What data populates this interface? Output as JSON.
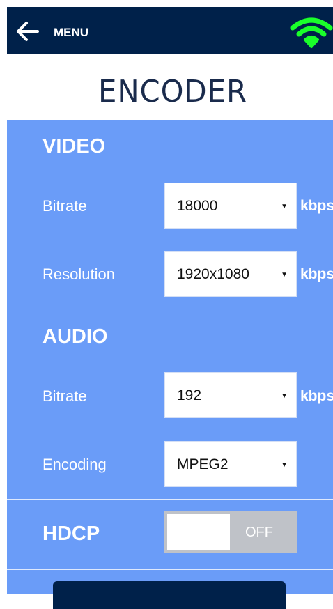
{
  "header": {
    "menu_label": "MENU",
    "back_icon": "arrow-left-icon",
    "status_icon": "wifi-icon",
    "wifi_color": "#1aff2a"
  },
  "page": {
    "title": "ENCODER"
  },
  "video": {
    "title": "VIDEO",
    "bitrate_label": "Bitrate",
    "bitrate_value": "18000",
    "bitrate_unit": "kbps",
    "resolution_label": "Resolution",
    "resolution_value": "1920x1080",
    "resolution_unit": "kbps"
  },
  "audio": {
    "title": "AUDIO",
    "bitrate_label": "Bitrate",
    "bitrate_value": "192",
    "bitrate_unit": "kbps",
    "encoding_label": "Encoding",
    "encoding_value": "MPEG2"
  },
  "hdcp": {
    "title": "HDCP",
    "state": "OFF"
  },
  "colors": {
    "header_bg": "#00214a",
    "panel_bg": "#6a9cf8",
    "toggle_bg": "#bfc2c8"
  }
}
